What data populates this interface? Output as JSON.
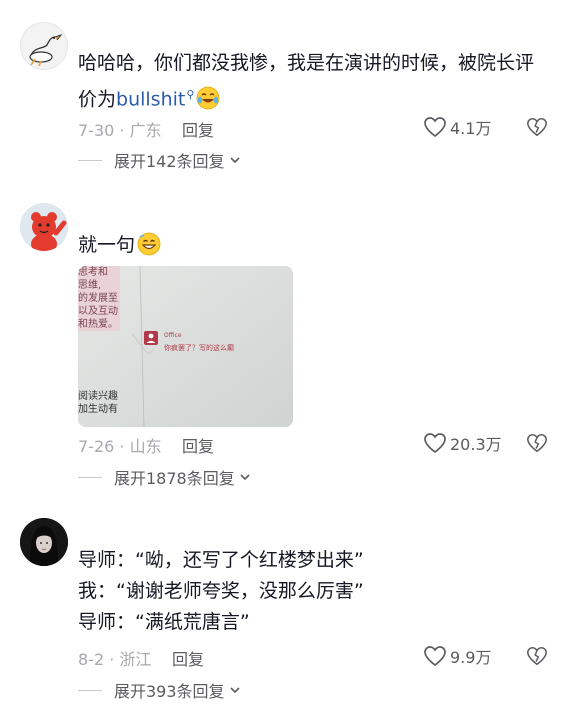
{
  "comments": [
    {
      "text_line1": "哈哈哈，你们都没我惨，我是在演讲的时候，被院长评",
      "text_line2_prefix": "价为",
      "keyword": "bullshit",
      "date_location": "7-30 · 广东",
      "reply_label": "回复",
      "like_count": "4.1万",
      "expand_label": "展开142条回复"
    },
    {
      "text": "就一句",
      "photo": {
        "left_text": [
          "思考和",
          "思维,",
          "的发展至",
          "以及互动",
          "和热爱。"
        ],
        "left_bottom_text": [
          "阅读兴趣",
          "加生动有"
        ],
        "office_label": "Office",
        "comment_text": "你疯罢了？写的这么癫"
      },
      "date_location": "7-26 · 山东",
      "reply_label": "回复",
      "like_count": "20.3万",
      "expand_label": "展开1878条回复"
    },
    {
      "lines": [
        "导师：“呦，还写了个红楼梦出来”",
        "我：“谢谢老师夸奖，没那么厉害”",
        "导师：“满纸荒唐言”"
      ],
      "date_location": "8-2 · 浙江",
      "reply_label": "回复",
      "like_count": "9.9万",
      "expand_label": "展开393条回复"
    }
  ],
  "colors": {
    "text": "#161823",
    "secondary": "#5b5c61",
    "muted": "#a8a9ad",
    "keyword": "#2b5ca8",
    "office_red": "#b23a48"
  },
  "icons": [
    "heart-icon",
    "broken-heart-icon",
    "chevron-down-icon",
    "search-icon",
    "laughing-crying-emoji",
    "grinning-emoji"
  ]
}
